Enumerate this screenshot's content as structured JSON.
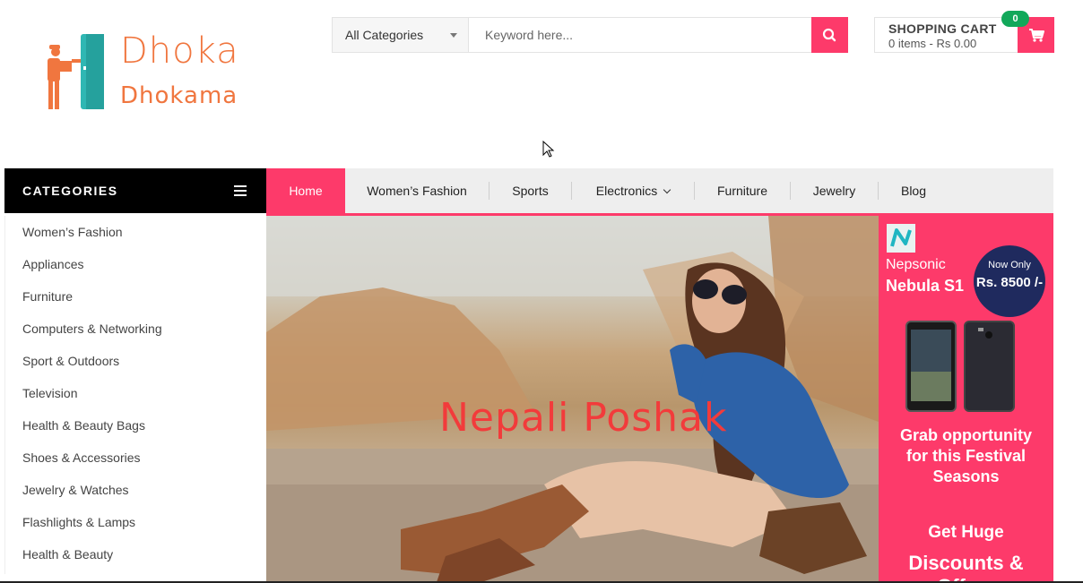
{
  "brand": {
    "line1": "Dhoka",
    "line2": "Dhokama",
    "primary_color": "#f0763f",
    "accent_color": "#2fb7b3"
  },
  "search": {
    "category_selected": "All Categories",
    "keyword_placeholder": "Keyword here...",
    "button_icon": "search-icon"
  },
  "cart": {
    "title": "SHOPPING CART",
    "summary": "0 items - Rs 0.00",
    "badge_count": "0",
    "icon": "cart-icon"
  },
  "categories_header": {
    "label": "CATEGORIES",
    "icon": "hamburger-icon"
  },
  "nav": {
    "items": [
      {
        "label": "Home",
        "active": true
      },
      {
        "label": "Women’s Fashion"
      },
      {
        "label": "Sports"
      },
      {
        "label": "Electronics",
        "has_dropdown": true
      },
      {
        "label": "Furniture"
      },
      {
        "label": "Jewelry"
      },
      {
        "label": "Blog"
      }
    ]
  },
  "sidebar": {
    "items": [
      "Women’s Fashion",
      "Appliances",
      "Furniture",
      "Computers & Networking",
      "Sport & Outdoors",
      "Television",
      "Health & Beauty Bags",
      "Shoes & Accessories",
      "Jewelry & Watches",
      "Flashlights & Lamps",
      "Health & Beauty"
    ]
  },
  "hero": {
    "caption": "Nepali Poshak"
  },
  "promo": {
    "brand": "Nepsonic",
    "model": "Nebula S1",
    "now_only": "Now Only",
    "price": "Rs. 8500 /-",
    "grab": "Grab opportunity for this Festival Seasons",
    "get_huge": "Get Huge",
    "discounts": "Discounts & Offers"
  },
  "colors": {
    "accent": "#fd3a6a",
    "navbar_bg": "#eeeeee",
    "badge": "#12a85a",
    "category_header_bg": "#000000"
  }
}
